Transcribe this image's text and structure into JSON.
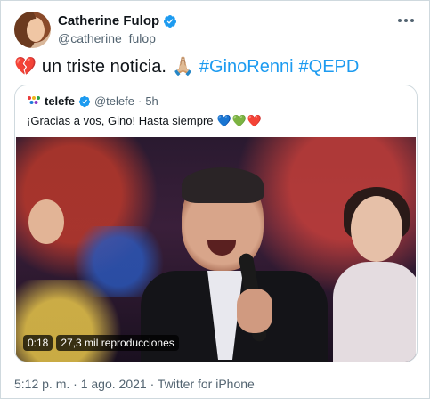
{
  "author": {
    "display_name": "Catherine Fulop",
    "handle": "@catherine_fulop"
  },
  "tweet": {
    "emoji_broken_heart": "💔",
    "text": "un triste noticia.",
    "emoji_pray": "🙏🏼",
    "hashtags": [
      "#GinoRenni",
      "#QEPD"
    ]
  },
  "quoted_tweet": {
    "display_name": "telefe",
    "handle": "@telefe",
    "separator": "·",
    "time": "5h",
    "text": "¡Gracias a vos, Gino! Hasta siempre",
    "hearts": [
      "💙",
      "💚",
      "❤️"
    ]
  },
  "video": {
    "duration": "0:18",
    "views": "27,3 mil reproducciones"
  },
  "meta": {
    "time": "5:12 p. m.",
    "separator1": "·",
    "date": "1 ago. 2021",
    "separator2": "·",
    "source": "Twitter for iPhone"
  },
  "colors": {
    "verified": "#1d9bf0",
    "hashtag": "#1d9bf0",
    "muted": "#536471",
    "border": "#cfd9de"
  },
  "icons": {
    "verified": "verified-badge-icon",
    "more": "more-horizontal-icon",
    "telefe_logo": "telefe-logo-icon"
  }
}
